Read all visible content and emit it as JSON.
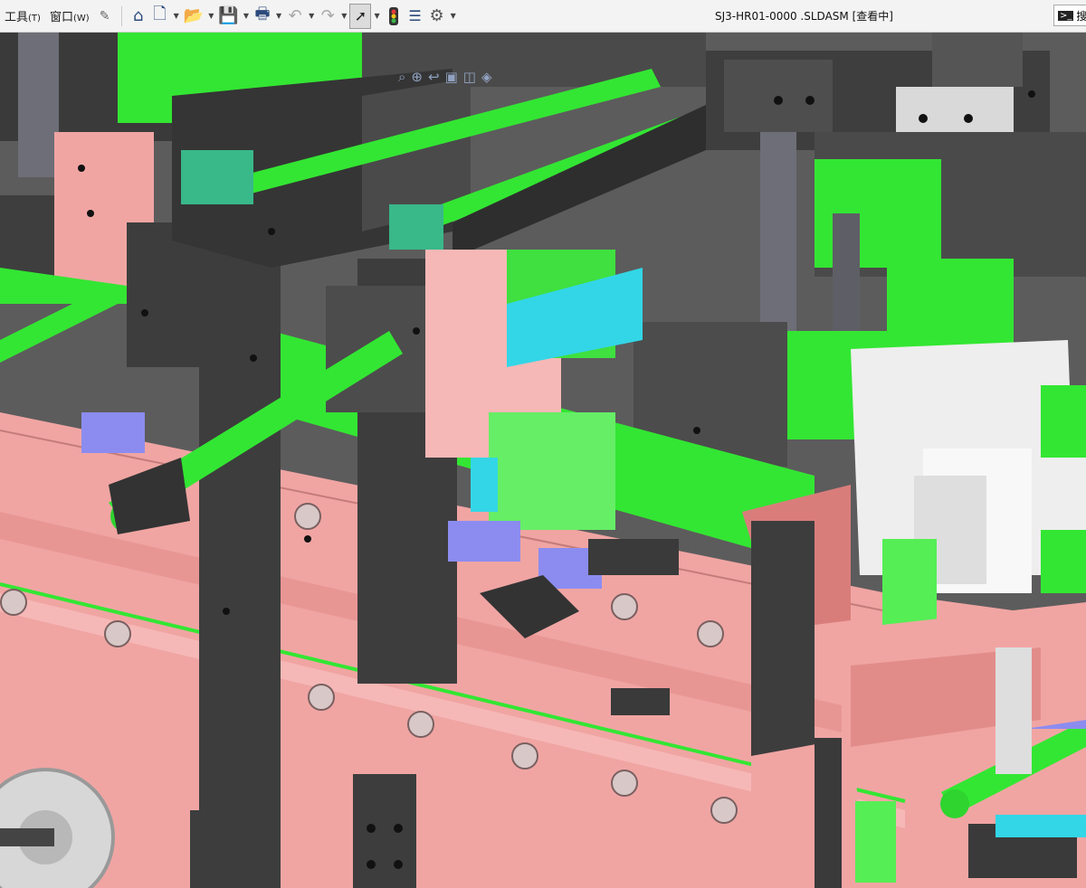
{
  "menubar": {
    "tools": "工具",
    "tools_key": "(T)",
    "window": "窗口",
    "window_key": "(W)"
  },
  "toolbar": {
    "icons": [
      "pin-icon",
      "home-icon",
      "new-document-icon",
      "open-file-icon",
      "save-icon",
      "print-icon",
      "undo-icon",
      "redo-icon",
      "select-arrow-icon",
      "traffic-light-icon",
      "file-properties-icon",
      "gear-icon"
    ]
  },
  "title": {
    "text": "SJ3-HR01-0000 .SLDASM [查看中]"
  },
  "search": {
    "text": "搜"
  },
  "colors": {
    "toolbar_bg": "#f3f3f3",
    "frame_pink": "#f0a5a3",
    "part_green": "#33e633",
    "dark_gray": "#4a4a4a",
    "cyan": "#33d6e6",
    "lavender": "#8c8cf0",
    "white_part": "#eeeeee",
    "background_gray": "#5a5a5a"
  }
}
